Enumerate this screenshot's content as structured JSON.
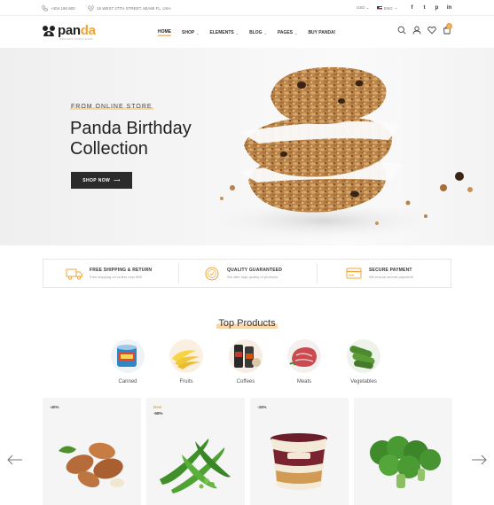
{
  "topbar": {
    "phone": "+404 196 900",
    "address": "15 WEST 27TH STREET, MIAMI FL, USA",
    "currency": "USD",
    "language": "ENG",
    "social_icons": [
      "facebook-icon",
      "twitter-icon",
      "pinterest-icon",
      "linkedin-icon"
    ],
    "social_glyphs": [
      "f",
      "t",
      "p",
      "in"
    ]
  },
  "header": {
    "logo_text": "pan",
    "logo_accent": "da",
    "logo_tagline": "ORGANIC FOOD SHOP",
    "cart_count": "0",
    "nav": [
      {
        "label": "HOME",
        "active": true,
        "dropdown": false
      },
      {
        "label": "SHOP",
        "active": false,
        "dropdown": true
      },
      {
        "label": "ELEMENTS",
        "active": false,
        "dropdown": true
      },
      {
        "label": "BLOG",
        "active": false,
        "dropdown": true
      },
      {
        "label": "PAGES",
        "active": false,
        "dropdown": true
      },
      {
        "label": "BUY PANDA!",
        "active": false,
        "dropdown": false
      }
    ]
  },
  "hero": {
    "subtitle": "FROM ONLINE STORE",
    "title": "Panda Birthday Collection",
    "button_label": "SHOP NOW"
  },
  "features": [
    {
      "title": "FREE SHIPPING & RETURN",
      "desc": "Free shipping on orders over $99",
      "icon": "truck-icon"
    },
    {
      "title": "QUALITY GUARANTEED",
      "desc": "We offer high quality of products",
      "icon": "quality-badge-icon"
    },
    {
      "title": "SECURE PAYMENT",
      "desc": "We ensure secure payment!",
      "icon": "payment-icon"
    }
  ],
  "top_products": {
    "title": "Top Products",
    "categories": [
      {
        "label": "Canned",
        "icon": "canned-icon"
      },
      {
        "label": "Fruits",
        "icon": "banana-icon"
      },
      {
        "label": "Coffees",
        "icon": "coffee-icon"
      },
      {
        "label": "Meats",
        "icon": "meat-icon"
      },
      {
        "label": "Vegetables",
        "icon": "cucumber-icon"
      }
    ]
  },
  "products": [
    {
      "new": "",
      "discount": "-40%",
      "image": "almonds-image"
    },
    {
      "new": "New",
      "discount": "-58%",
      "image": "green-beans-image"
    },
    {
      "new": "",
      "discount": "-34%",
      "image": "ice-cream-image"
    },
    {
      "new": "",
      "discount": "",
      "image": "broccoli-image"
    }
  ],
  "colors": {
    "accent": "#f0a43a",
    "highlight": "#f7d7aa",
    "dark_button": "#2b2b2b"
  }
}
